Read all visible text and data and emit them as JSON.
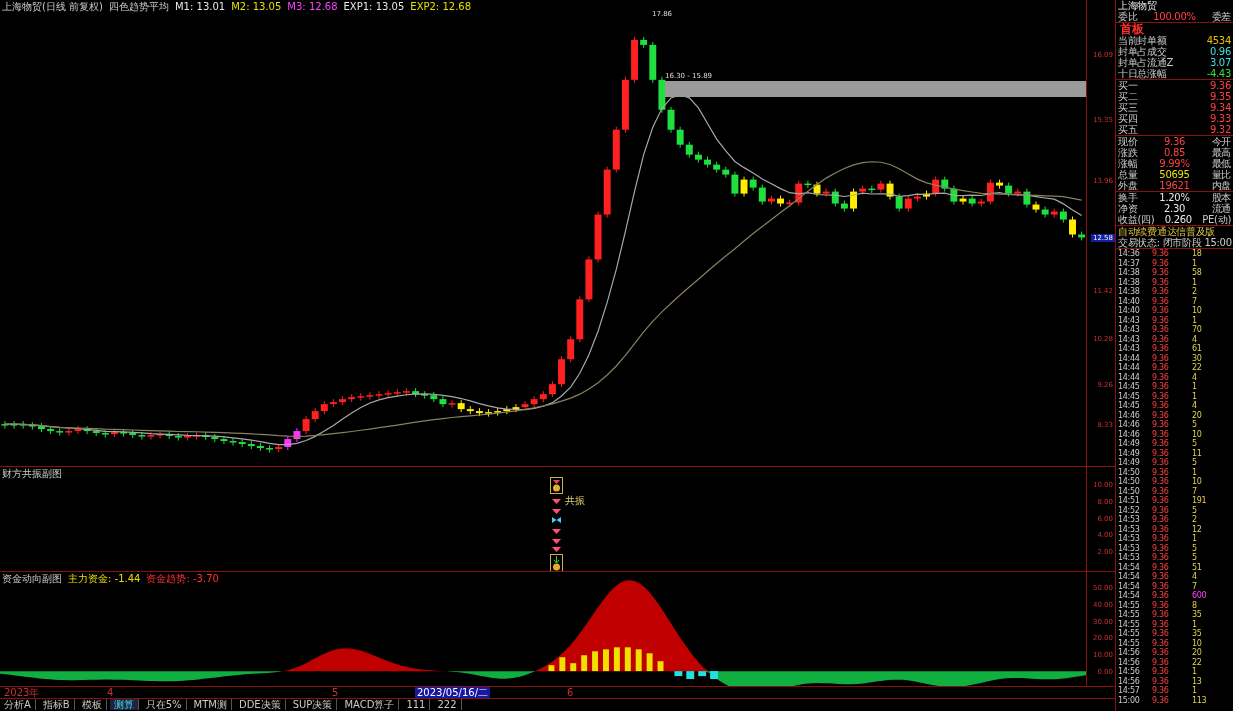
{
  "legend": {
    "title": "上海物贸(日线 前复权)",
    "indicator": "四色趋势平均",
    "items": [
      {
        "label": "M1:",
        "value": "13.01",
        "color": "#e8e8e8"
      },
      {
        "label": "M2:",
        "value": "13.05",
        "color": "#e8e000"
      },
      {
        "label": "M3:",
        "value": "12.68",
        "color": "#ff40ff"
      },
      {
        "label": "EXP1:",
        "value": "13.05",
        "color": "#e8e8e8"
      },
      {
        "label": "EXP2:",
        "value": "12.68",
        "color": "#e8e000"
      }
    ]
  },
  "main_axis": [
    "16.09",
    "15.35",
    "13.96",
    "11.42",
    "10.28",
    "9.26",
    "8.33"
  ],
  "price_tag": "12.58",
  "annotations": {
    "peak": "17.86",
    "range": "16.30 - 15.89"
  },
  "indicator_1": {
    "title": "财方共振副图",
    "signal_label": "共振",
    "axis": [
      "10.00",
      "8.00",
      "6.00",
      "4.00",
      "2.00"
    ]
  },
  "indicator_2": {
    "title": "资金动向副图",
    "items": [
      {
        "label": "主力资金:",
        "value": "-1.44",
        "color": "#e8e000"
      },
      {
        "label": "资金趋势:",
        "value": "-3.70",
        "color": "#ff3030"
      }
    ],
    "axis": [
      "50.00",
      "40.00",
      "30.00",
      "20.00",
      "10.00",
      "0.00"
    ]
  },
  "time_axis": [
    {
      "label": "2023年",
      "selected": false
    },
    {
      "label": "4",
      "selected": false
    },
    {
      "label": "5",
      "selected": false
    },
    {
      "label": "2023/05/16/二",
      "selected": true
    },
    {
      "label": "6",
      "selected": false
    }
  ],
  "tabs": [
    {
      "label": "分析A",
      "selected": false
    },
    {
      "label": "指标B",
      "selected": false
    },
    {
      "label": "模板",
      "selected": false
    },
    {
      "label": "测算",
      "selected": true
    },
    {
      "label": "只在5%",
      "selected": false
    },
    {
      "label": "MTM测",
      "selected": false
    },
    {
      "label": "DDE决策",
      "selected": false
    },
    {
      "label": "SUP决策",
      "selected": false
    },
    {
      "label": "MACD算子",
      "selected": false
    },
    {
      "label": "111",
      "selected": false
    },
    {
      "label": "222",
      "selected": false
    }
  ],
  "quote": {
    "name": "上海物贸",
    "ratio": {
      "label": "委比",
      "value": "100.00%",
      "extra": "委差"
    },
    "board": {
      "title": "首板",
      "rows": [
        {
          "label": "当前封单额",
          "value": "4534",
          "color": "#e8c000"
        },
        {
          "label": "封单占成交",
          "value": "0.96",
          "color": "#40e0e0"
        },
        {
          "label": "封单占流通Z",
          "value": "3.07",
          "color": "#40e0e0"
        },
        {
          "label": "十日总涨幅",
          "value": "-4.43",
          "color": "#30e030"
        }
      ]
    },
    "bids": [
      {
        "label": "买一",
        "price": "9.36"
      },
      {
        "label": "买二",
        "price": "9.35"
      },
      {
        "label": "买三",
        "price": "9.34"
      },
      {
        "label": "买四",
        "price": "9.33"
      },
      {
        "label": "买五",
        "price": "9.32"
      }
    ],
    "stats": [
      {
        "label": "现价",
        "value": "9.36",
        "extra": "今开",
        "color": "#ff4040"
      },
      {
        "label": "涨跌",
        "value": "0.85",
        "extra": "最高",
        "color": "#ff4040"
      },
      {
        "label": "涨幅",
        "value": "9.99%",
        "extra": "最低",
        "color": "#ff4040"
      },
      {
        "label": "总量",
        "value": "50695",
        "extra": "量比",
        "color": "#e8e000"
      },
      {
        "label": "外盘",
        "value": "19621",
        "extra": "内盘",
        "color": "#ff4040"
      }
    ],
    "info": [
      {
        "label": "换手",
        "value": "1.20%",
        "extra": "股本"
      },
      {
        "label": "净资",
        "value": "2.30",
        "extra": "流通"
      },
      {
        "label": "收益(四)",
        "value": "0.260",
        "extra": "PE(动)"
      }
    ],
    "notices": [
      "自动续费通达信普及版",
      "交易状态: 闭市阶段 15:00"
    ],
    "ticks": [
      {
        "time": "14:36",
        "price": "9.36",
        "volume": "18",
        "highlight": false
      },
      {
        "time": "14:37",
        "price": "9.36",
        "volume": "1",
        "highlight": false
      },
      {
        "time": "14:38",
        "price": "9.36",
        "volume": "58",
        "highlight": false
      },
      {
        "time": "14:38",
        "price": "9.36",
        "volume": "1",
        "highlight": false
      },
      {
        "time": "14:38",
        "price": "9.36",
        "volume": "2",
        "highlight": false
      },
      {
        "time": "14:40",
        "price": "9.36",
        "volume": "7",
        "highlight": false
      },
      {
        "time": "14:40",
        "price": "9.36",
        "volume": "10",
        "highlight": false
      },
      {
        "time": "14:43",
        "price": "9.36",
        "volume": "1",
        "highlight": false
      },
      {
        "time": "14:43",
        "price": "9.36",
        "volume": "70",
        "highlight": false
      },
      {
        "time": "14:43",
        "price": "9.36",
        "volume": "4",
        "highlight": false
      },
      {
        "time": "14:43",
        "price": "9.36",
        "volume": "61",
        "highlight": false
      },
      {
        "time": "14:44",
        "price": "9.36",
        "volume": "30",
        "highlight": false
      },
      {
        "time": "14:44",
        "price": "9.36",
        "volume": "22",
        "highlight": false
      },
      {
        "time": "14:44",
        "price": "9.36",
        "volume": "4",
        "highlight": false
      },
      {
        "time": "14:45",
        "price": "9.36",
        "volume": "1",
        "highlight": false
      },
      {
        "time": "14:45",
        "price": "9.36",
        "volume": "1",
        "highlight": false
      },
      {
        "time": "14:45",
        "price": "9.36",
        "volume": "4",
        "highlight": false
      },
      {
        "time": "14:46",
        "price": "9.36",
        "volume": "20",
        "highlight": false
      },
      {
        "time": "14:46",
        "price": "9.36",
        "volume": "5",
        "highlight": false
      },
      {
        "time": "14:46",
        "price": "9.36",
        "volume": "10",
        "highlight": false
      },
      {
        "time": "14:49",
        "price": "9.36",
        "volume": "5",
        "highlight": false
      },
      {
        "time": "14:49",
        "price": "9.36",
        "volume": "11",
        "highlight": false
      },
      {
        "time": "14:49",
        "price": "9.36",
        "volume": "5",
        "highlight": false
      },
      {
        "time": "14:50",
        "price": "9.36",
        "volume": "1",
        "highlight": false
      },
      {
        "time": "14:50",
        "price": "9.36",
        "volume": "10",
        "highlight": false
      },
      {
        "time": "14:50",
        "price": "9.36",
        "volume": "7",
        "highlight": false
      },
      {
        "time": "14:51",
        "price": "9.36",
        "volume": "191",
        "highlight": false
      },
      {
        "time": "14:52",
        "price": "9.36",
        "volume": "5",
        "highlight": false
      },
      {
        "time": "14:53",
        "price": "9.36",
        "volume": "2",
        "highlight": false
      },
      {
        "time": "14:53",
        "price": "9.36",
        "volume": "12",
        "highlight": false
      },
      {
        "time": "14:53",
        "price": "9.36",
        "volume": "1",
        "highlight": false
      },
      {
        "time": "14:53",
        "price": "9.36",
        "volume": "5",
        "highlight": false
      },
      {
        "time": "14:53",
        "price": "9.36",
        "volume": "5",
        "highlight": false
      },
      {
        "time": "14:54",
        "price": "9.36",
        "volume": "51",
        "highlight": false
      },
      {
        "time": "14:54",
        "price": "9.36",
        "volume": "4",
        "highlight": false
      },
      {
        "time": "14:54",
        "price": "9.36",
        "volume": "7",
        "highlight": false
      },
      {
        "time": "14:54",
        "price": "9.36",
        "volume": "600",
        "highlight": true
      },
      {
        "time": "14:55",
        "price": "9.36",
        "volume": "8",
        "highlight": false
      },
      {
        "time": "14:55",
        "price": "9.36",
        "volume": "35",
        "highlight": false
      },
      {
        "time": "14:55",
        "price": "9.36",
        "volume": "1",
        "highlight": false
      },
      {
        "time": "14:55",
        "price": "9.36",
        "volume": "35",
        "highlight": false
      },
      {
        "time": "14:55",
        "price": "9.36",
        "volume": "10",
        "highlight": false
      },
      {
        "time": "14:56",
        "price": "9.36",
        "volume": "20",
        "highlight": false
      },
      {
        "time": "14:56",
        "price": "9.36",
        "volume": "22",
        "highlight": false
      },
      {
        "time": "14:56",
        "price": "9.36",
        "volume": "1",
        "highlight": false
      },
      {
        "time": "14:56",
        "price": "9.36",
        "volume": "13",
        "highlight": false
      },
      {
        "time": "14:57",
        "price": "9.36",
        "volume": "1",
        "highlight": false
      },
      {
        "time": "15:00",
        "price": "9.36",
        "volume": "113",
        "highlight": false
      }
    ]
  }
}
